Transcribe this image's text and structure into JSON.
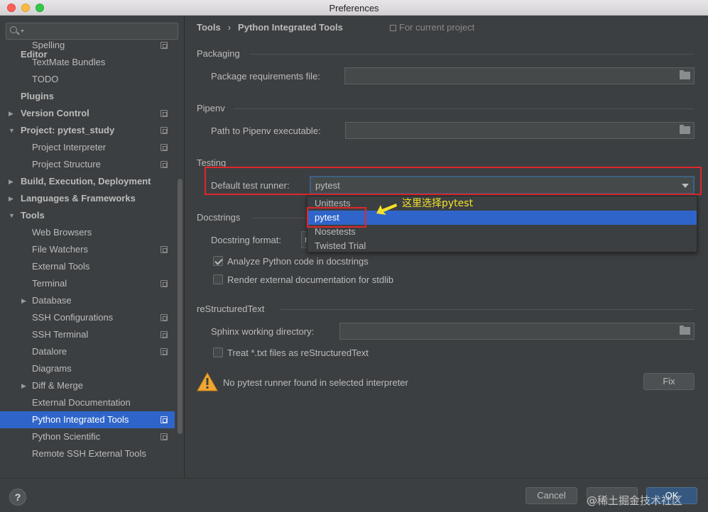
{
  "window": {
    "title": "Preferences"
  },
  "sidebar": {
    "search_placeholder": "",
    "editor_header": "Editor",
    "items": [
      {
        "label": "Spelling",
        "level": 1,
        "bold": false,
        "arrow": "",
        "project_icon": true,
        "selected": false
      },
      {
        "label": "TextMate Bundles",
        "level": 1,
        "bold": false,
        "arrow": "",
        "project_icon": false,
        "selected": false
      },
      {
        "label": "TODO",
        "level": 1,
        "bold": false,
        "arrow": "",
        "project_icon": false,
        "selected": false
      },
      {
        "label": "Plugins",
        "level": 0,
        "bold": true,
        "arrow": "",
        "project_icon": false,
        "selected": false
      },
      {
        "label": "Version Control",
        "level": 0,
        "bold": true,
        "arrow": "▶",
        "project_icon": true,
        "selected": false
      },
      {
        "label": "Project: pytest_study",
        "level": 0,
        "bold": true,
        "arrow": "▼",
        "project_icon": true,
        "selected": false
      },
      {
        "label": "Project Interpreter",
        "level": 1,
        "bold": false,
        "arrow": "",
        "project_icon": true,
        "selected": false
      },
      {
        "label": "Project Structure",
        "level": 1,
        "bold": false,
        "arrow": "",
        "project_icon": true,
        "selected": false
      },
      {
        "label": "Build, Execution, Deployment",
        "level": 0,
        "bold": true,
        "arrow": "▶",
        "project_icon": false,
        "selected": false
      },
      {
        "label": "Languages & Frameworks",
        "level": 0,
        "bold": true,
        "arrow": "▶",
        "project_icon": false,
        "selected": false
      },
      {
        "label": "Tools",
        "level": 0,
        "bold": true,
        "arrow": "▼",
        "project_icon": false,
        "selected": false
      },
      {
        "label": "Web Browsers",
        "level": 1,
        "bold": false,
        "arrow": "",
        "project_icon": false,
        "selected": false
      },
      {
        "label": "File Watchers",
        "level": 1,
        "bold": false,
        "arrow": "",
        "project_icon": true,
        "selected": false
      },
      {
        "label": "External Tools",
        "level": 1,
        "bold": false,
        "arrow": "",
        "project_icon": false,
        "selected": false
      },
      {
        "label": "Terminal",
        "level": 1,
        "bold": false,
        "arrow": "",
        "project_icon": true,
        "selected": false
      },
      {
        "label": "Database",
        "level": 1,
        "bold": false,
        "arrow": "▶",
        "project_icon": false,
        "selected": false
      },
      {
        "label": "SSH Configurations",
        "level": 1,
        "bold": false,
        "arrow": "",
        "project_icon": true,
        "selected": false
      },
      {
        "label": "SSH Terminal",
        "level": 1,
        "bold": false,
        "arrow": "",
        "project_icon": true,
        "selected": false
      },
      {
        "label": "Datalore",
        "level": 1,
        "bold": false,
        "arrow": "",
        "project_icon": true,
        "selected": false
      },
      {
        "label": "Diagrams",
        "level": 1,
        "bold": false,
        "arrow": "",
        "project_icon": false,
        "selected": false
      },
      {
        "label": "Diff & Merge",
        "level": 1,
        "bold": false,
        "arrow": "▶",
        "project_icon": false,
        "selected": false
      },
      {
        "label": "External Documentation",
        "level": 1,
        "bold": false,
        "arrow": "",
        "project_icon": false,
        "selected": false
      },
      {
        "label": "Python Integrated Tools",
        "level": 1,
        "bold": false,
        "arrow": "",
        "project_icon": true,
        "selected": true
      },
      {
        "label": "Python Scientific",
        "level": 1,
        "bold": false,
        "arrow": "",
        "project_icon": true,
        "selected": false
      },
      {
        "label": "Remote SSH External Tools",
        "level": 1,
        "bold": false,
        "arrow": "",
        "project_icon": false,
        "selected": false
      }
    ]
  },
  "main": {
    "breadcrumb": {
      "parent": "Tools",
      "separator": "›",
      "current": "Python Integrated Tools"
    },
    "for_current_project": "For current project",
    "packaging": {
      "title": "Packaging",
      "req_label": "Package requirements file:",
      "req_value": ""
    },
    "pipenv": {
      "title": "Pipenv",
      "path_label": "Path to Pipenv executable:",
      "path_value": ""
    },
    "testing": {
      "title": "Testing",
      "runner_label": "Default test runner:",
      "runner_value": "pytest",
      "options": [
        "Unittests",
        "pytest",
        "Nosetests",
        "Twisted Trial"
      ],
      "highlighted_option": "pytest"
    },
    "annotation": "这里选择pytest",
    "docstrings": {
      "title": "Docstrings",
      "format_label": "Docstring format:",
      "format_value_partial": "r",
      "analyze_label": "Analyze Python code in docstrings",
      "analyze_checked": true,
      "render_label": "Render external documentation for stdlib",
      "render_checked": false
    },
    "rst": {
      "title": "reStructuredText",
      "sphinx_label": "Sphinx working directory:",
      "sphinx_value": "",
      "treat_label": "Treat *.txt files as reStructuredText",
      "treat_checked": false
    },
    "warning": {
      "text": "No pytest runner found in selected interpreter",
      "fix_label": "Fix"
    }
  },
  "footer": {
    "help_label": "?",
    "cancel_label": "Cancel",
    "ok_label": "OK",
    "watermark": "@稀土掘金技术社区"
  },
  "colors": {
    "accent": "#2f65ca",
    "highlight_border": "#e0262a",
    "annotation": "#f6e02a",
    "background": "#3c3f41"
  }
}
